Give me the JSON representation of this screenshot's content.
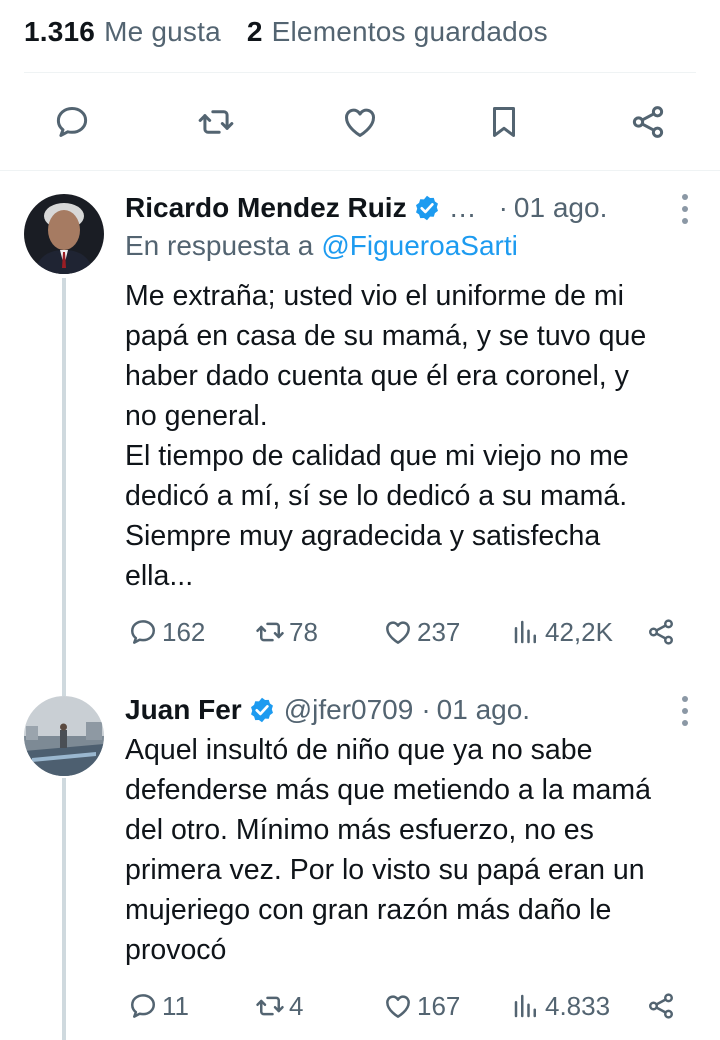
{
  "stats": {
    "likes_count": "1.316",
    "likes_label": "Me gusta",
    "bookmarks_count": "2",
    "bookmarks_label": "Elementos guardados"
  },
  "action_bar": {
    "icons": [
      "reply-icon",
      "retweet-icon",
      "like-icon",
      "bookmark-icon",
      "share-icon"
    ]
  },
  "replies": [
    {
      "author_name": "Ricardo Mendez Ruiz",
      "verified": true,
      "handle_truncated": "…",
      "separator": "·",
      "time": "01 ago.",
      "reply_prefix": "En respuesta a",
      "reply_mention": "@FigueroaSarti",
      "text": "Me extraña; usted vio el uniforme de mi\npapá en casa de su mamá, y se tuvo que\nhaber dado cuenta que él era coronel, y\nno general.\nEl tiempo de calidad que mi viejo no me\ndedicó a mí, sí se lo dedicó a su mamá.\nSiempre muy agradecida y satisfecha\nella...",
      "replies": "162",
      "retweets": "78",
      "likes": "237",
      "views": "42,2K"
    },
    {
      "author_name": "Juan Fer",
      "verified": true,
      "handle": "@jfer0709",
      "separator": "·",
      "time": "01 ago.",
      "text": "Aquel insultó de niño que ya no sabe\ndefenderse más que metiendo a la mamá\ndel otro. Mínimo más esfuerzo, no es\nprimera vez. Por lo visto su papá eran un\nmujeriego con gran razón más daño le\nprovocó",
      "replies": "11",
      "retweets": "4",
      "likes": "167",
      "views": "4.833"
    }
  ],
  "colors": {
    "text": "#0f1419",
    "secondary": "#536471",
    "accent": "#1d9bf0",
    "divider": "#eff3f4",
    "thread_line": "#cfd9de"
  }
}
